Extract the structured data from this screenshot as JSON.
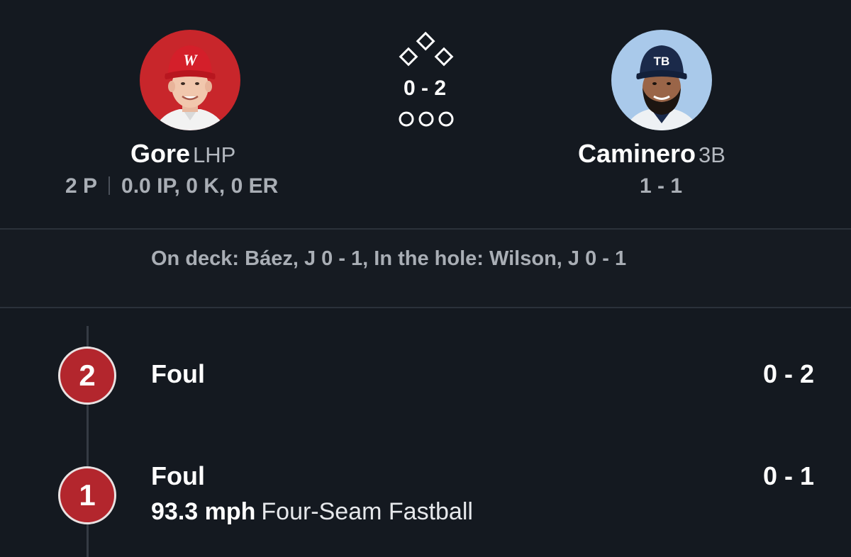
{
  "pitcher": {
    "name": "Gore",
    "position": "LHP",
    "pitches": "2 P",
    "stats": "0.0 IP, 0 K, 0 ER",
    "cap_logo": "W"
  },
  "batter": {
    "name": "Caminero",
    "position": "3B",
    "record": "1 - 1",
    "cap_logo": "TB"
  },
  "situation": {
    "count": "0 - 2",
    "bases": {
      "first": false,
      "second": false,
      "third": false
    },
    "outs": 0
  },
  "on_deck_text": "On deck: Báez, J 0 - 1, In the hole: Wilson, J 0 - 1",
  "pitches": [
    {
      "number": "2",
      "result": "Foul",
      "count": "0 - 2"
    },
    {
      "number": "1",
      "result": "Foul",
      "count": "0 - 1",
      "speed": "93.3 mph",
      "pitch_type": "Four-Seam Fastball"
    }
  ],
  "colors": {
    "background": "#141920",
    "pitch_badge": "#b3262d",
    "muted_text": "#a9aeb5",
    "pitcher_bg": "#c8262b",
    "batter_bg": "#a9c9ea"
  }
}
